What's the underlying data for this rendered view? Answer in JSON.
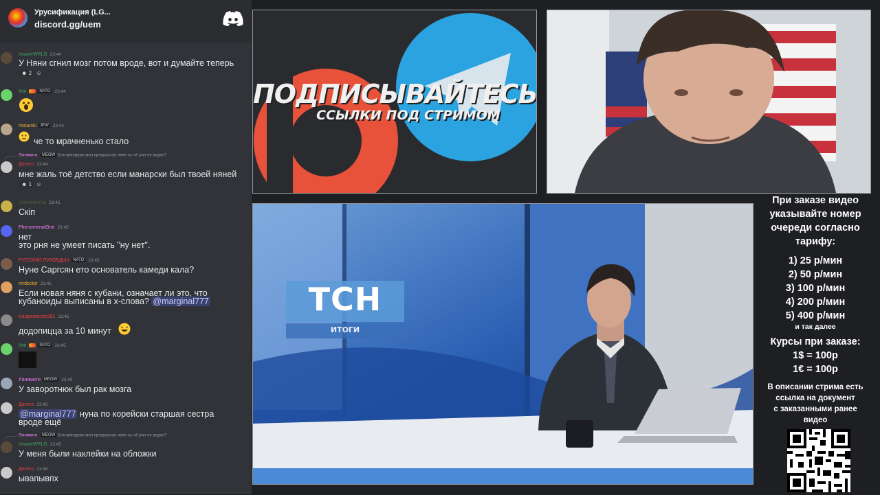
{
  "chat": {
    "server_name": "Урусификация (LG...",
    "server_invite": "discord.gg/uem",
    "messages": [
      {
        "user": "InsaneWRLD",
        "badge": "",
        "time": "23:44",
        "text": "У Няни сгнил мозг потом вроде, вот и думайте теперь",
        "reaction": "2",
        "color": "#3ba55d"
      },
      {
        "user": "Ihtir",
        "badge": "NATO",
        "time": "23:44",
        "text": "",
        "color": "#3ba55d"
      },
      {
        "user": "minarski",
        "badge": "JEW",
        "time": "23:44",
        "text": "че то мрачненько стало",
        "color": "#f0b232"
      },
      {
        "reply_user": "Лянямити",
        "reply_badge": "MEOW",
        "reply_text": "Бля минарски моя прекрасная няня ты чё рил не видел?",
        "user": "Дezero",
        "badge": "",
        "time": "23:44",
        "text": "мне жаль тоё детство если манарски был твоей няней",
        "reaction": "1",
        "color": "#f23f43"
      },
      {
        "user": "UnknownCat",
        "badge": "",
        "time": "23:45",
        "text": "Скіп",
        "color": "#3ba55d"
      },
      {
        "user": "PhenomenalOne",
        "badge": "",
        "time": "23:45",
        "text_lines": [
          "нет",
          "это рня не умеет писать \"ну нет\"."
        ],
        "color": "#f47fff"
      },
      {
        "user": "РУССКИЙ ПУКОВДЫХ",
        "badge": "NATO",
        "time": "23:45",
        "text": "Нуне Саргсян ето основатель камеди кала?",
        "color": "#f23f43"
      },
      {
        "user": "mrdoctor",
        "badge": "",
        "time": "23:45",
        "text_lines": [
          "Если новая няня с кубани, означает ли это, что",
          "кубаноиды выписаны в х-слова?"
        ],
        "mention": "@marginal777",
        "color": "#f0b232"
      },
      {
        "user": "Kalaprotector282",
        "badge": "",
        "time": "23:45",
        "text": "додопицца за 10 минут",
        "color": "#f23f43"
      },
      {
        "user": "Ihtir",
        "badge": "NATO",
        "time": "23:45",
        "text": "",
        "color": "#3ba55d"
      },
      {
        "user": "Лянямити",
        "badge": "MEOW",
        "time": "23:45",
        "text": "У заворотнюк был рак мозга",
        "color": "#f47fff"
      },
      {
        "user": "Дezero",
        "badge": "",
        "time": "23:45",
        "mention": "@marginal777",
        "text_lines": [
          "нуна по корейски старшая сестра",
          "вроде ещё"
        ],
        "color": "#f23f43"
      },
      {
        "reply_user": "Лянямити",
        "reply_badge": "MEOW",
        "reply_text": "Бля минарски моя прекрасная няня ты чё рил не видел?",
        "user": "InsaneWRLD",
        "badge": "",
        "time": "23:45",
        "text": "У меня были наклейки на обложки",
        "color": "#3ba55d"
      },
      {
        "user": "Дezero",
        "badge": "",
        "time": "23:46",
        "text": "ывапывпх",
        "color": "#f23f43"
      }
    ]
  },
  "promo": {
    "headline": "ПОДПИСЫВАЙТЕСЬ",
    "subline": "ССЫЛКИ ПОД СТРИМОМ"
  },
  "video": {
    "logo": "ТСН",
    "logo_sub": "ИТОГИ"
  },
  "info": {
    "heading_lines": [
      "При заказе видео",
      "указывайте номер",
      "очереди согласно",
      "тарифу:"
    ],
    "prices": [
      "1) 25 р/мин",
      "2) 50 р/мин",
      "3) 100 р/мин",
      "4) 200 р/мин",
      "5) 400 р/мин"
    ],
    "and_so_on": "и так далее",
    "rates_title": "Курсы при заказе:",
    "rates": [
      "1$ = 100р",
      "1€ = 100р"
    ],
    "desc_lines": [
      "В описании стрима есть",
      "ссылка на документ",
      "с заказанными ранее",
      "видео"
    ]
  },
  "colors": {
    "chat_bg": "#313338",
    "page_bg": "#1e1f22",
    "telegram_blue": "#2aa3e0",
    "patreon_red": "#e8513a",
    "news_blue": "#1b3f7a"
  }
}
